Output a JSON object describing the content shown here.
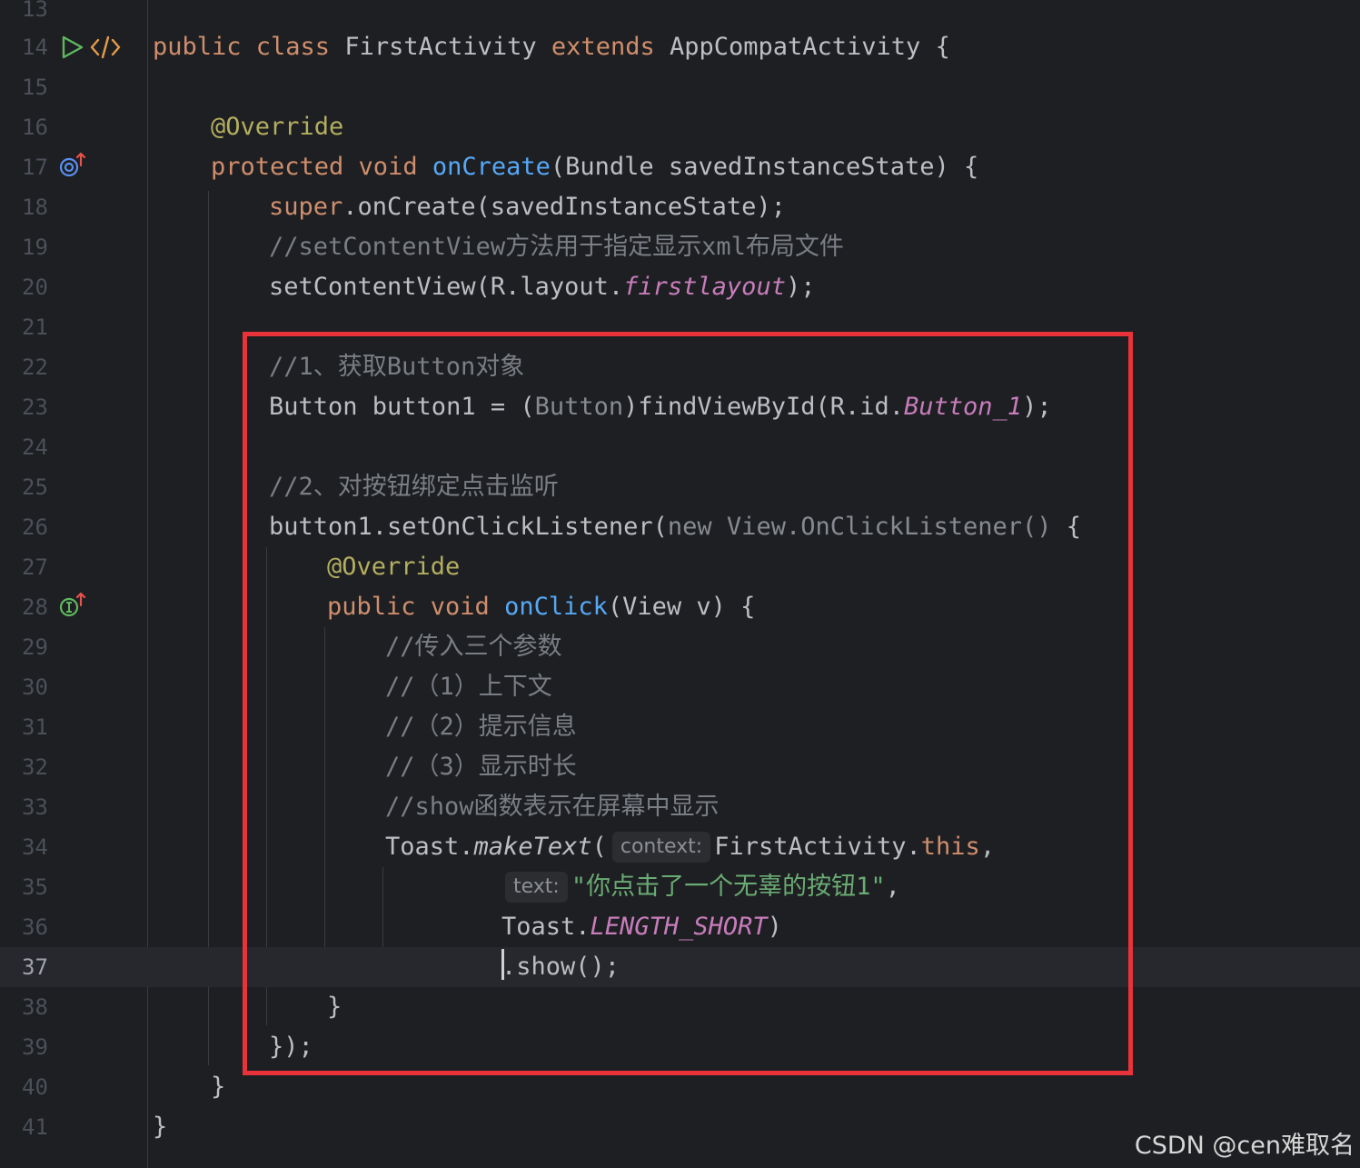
{
  "editor": {
    "current_line": "37",
    "line_numbers": [
      "13",
      "14",
      "15",
      "16",
      "17",
      "18",
      "19",
      "20",
      "21",
      "22",
      "23",
      "24",
      "25",
      "26",
      "27",
      "28",
      "29",
      "30",
      "31",
      "32",
      "33",
      "34",
      "35",
      "36",
      "37",
      "38",
      "39",
      "40",
      "41"
    ],
    "colors": {
      "background": "#1e1f22",
      "keyword": "#cf8e6d",
      "annotation": "#b3ae60",
      "method": "#56a8f5",
      "comment": "#7a7e85",
      "string": "#6aab73",
      "field": "#c77dbb",
      "highlight_box": "#e8333a"
    },
    "gutter_icons": {
      "run": "run-icon",
      "html_tag": "code-tag-icon",
      "override_method": "override-up-arrow-icon",
      "implement_method": "implement-up-arrow-icon"
    }
  },
  "code": {
    "l14": {
      "kw1": "public class",
      "name": " FirstActivity ",
      "kw2": "extends",
      "rest": " AppCompatActivity {"
    },
    "l16": {
      "ann": "@Override"
    },
    "l17": {
      "kw": "protected void",
      "sp": " ",
      "fn": "onCreate",
      "rest": "(Bundle savedInstanceState) {"
    },
    "l18": {
      "kw": "super",
      "rest": ".onCreate(savedInstanceState);"
    },
    "l19": {
      "cmt": "//setContentView方法用于指定显示xml布局文件"
    },
    "l20": {
      "pre": "setContentView(R.layout.",
      "field": "firstlayout",
      "post": ");"
    },
    "l22": {
      "cmt": "//1、获取Button对象"
    },
    "l23": {
      "pre": "Button button1 = (",
      "dim": "Button",
      "mid": ")findViewById(R.id.",
      "field": "Button_1",
      "post": ");"
    },
    "l25": {
      "cmt": "//2、对按钮绑定点击监听"
    },
    "l26": {
      "pre": "button1.setOnClickListener(",
      "dim": "new View.OnClickListener()",
      "post": " {"
    },
    "l27": {
      "ann": "@Override"
    },
    "l28": {
      "kw": "public void",
      "sp": " ",
      "fn": "onClick",
      "rest": "(View v) {"
    },
    "l29": {
      "cmt": "//传入三个参数"
    },
    "l30": {
      "cmt": "//（1）上下文"
    },
    "l31": {
      "cmt": "//（2）提示信息"
    },
    "l32": {
      "cmt": "//（3）显示时长"
    },
    "l33": {
      "cmt": "//show函数表示在屏幕中显示"
    },
    "l34": {
      "pre": "Toast.",
      "ital": "makeText",
      "open": "(",
      "hint": "context:",
      "mid": "FirstActivity.",
      "kw": "this",
      "post": ","
    },
    "l35": {
      "hint": "text:",
      "str": "\"你点击了一个无辜的按钮1\"",
      "post": ","
    },
    "l36": {
      "pre": "Toast.",
      "field": "LENGTH_SHORT",
      "post": ")"
    },
    "l37": {
      "text": ".show();"
    },
    "l38": {
      "text": "}"
    },
    "l39": {
      "text": "});"
    },
    "l40": {
      "text": "}"
    },
    "l41": {
      "text": "}"
    }
  },
  "watermark": {
    "text": "CSDN @cen难取名"
  }
}
